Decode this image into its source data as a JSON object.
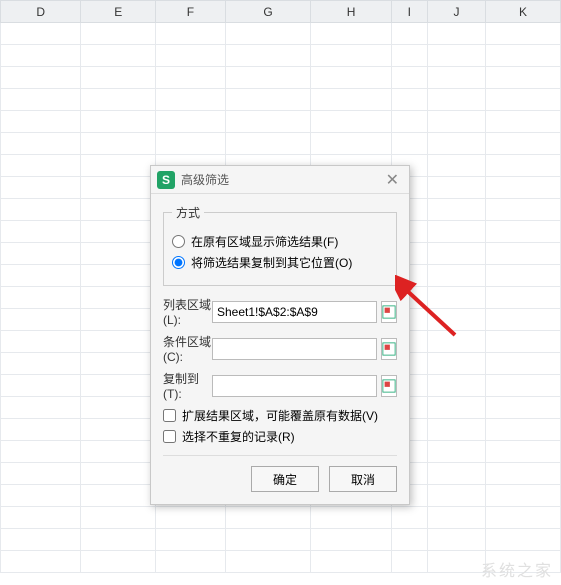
{
  "columns": [
    "D",
    "E",
    "F",
    "G",
    "H",
    "I",
    "J",
    "K"
  ],
  "dialog": {
    "title": "高级筛选",
    "mode_legend": "方式",
    "radio_filter_in_place": "在原有区域显示筛选结果(F)",
    "radio_copy_to": "将筛选结果复制到其它位置(O)",
    "list_range_label": "列表区域(L):",
    "list_range_value": "Sheet1!$A$2:$A$9",
    "criteria_label": "条件区域(C):",
    "criteria_value": "",
    "copy_to_label": "复制到(T):",
    "copy_to_value": "",
    "expand_label": "扩展结果区域，可能覆盖原有数据(V)",
    "unique_label": "选择不重复的记录(R)",
    "ok_label": "确定",
    "cancel_label": "取消"
  },
  "watermark": "系统之家"
}
